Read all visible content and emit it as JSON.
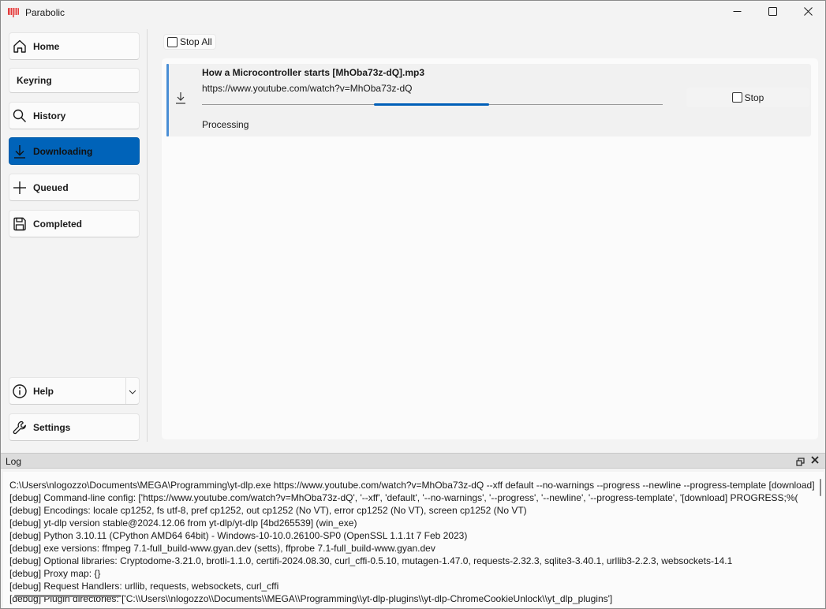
{
  "window": {
    "title": "Parabolic",
    "controls": {
      "minimize": "minimize",
      "maximize": "maximize",
      "close": "close"
    }
  },
  "sidebar": {
    "items": [
      {
        "label": "Home",
        "icon": "home-icon",
        "active": false
      },
      {
        "label": "Keyring",
        "icon": "",
        "active": false
      },
      {
        "label": "History",
        "icon": "search-icon",
        "active": false
      },
      {
        "label": "Downloading",
        "icon": "download-icon",
        "active": true
      },
      {
        "label": "Queued",
        "icon": "plus-icon",
        "active": false
      },
      {
        "label": "Completed",
        "icon": "save-icon",
        "active": false
      }
    ],
    "bottom_items": [
      {
        "label": "Help",
        "icon": "info-icon",
        "has_dropdown": true
      },
      {
        "label": "Settings",
        "icon": "wrench-icon"
      }
    ]
  },
  "toolbar": {
    "stop_all_label": "Stop All",
    "stop_all_checked": false
  },
  "downloads": [
    {
      "title": "How a Microcontroller starts [MhOba73z-dQ].mp3",
      "url": "https://www.youtube.com/watch?v=MhOba73z-dQ",
      "status": "Processing",
      "progress": "indeterminate",
      "stop_label": "Stop",
      "stop_checked": false
    }
  ],
  "log": {
    "title": "Log",
    "lines": [
      "C:\\Users\\nlogozzo\\Documents\\MEGA\\Programming\\yt-dlp.exe https://www.youtube.com/watch?v=MhOba73z-dQ --xff default --no-warnings --progress --newline --progress-template [download] PROGRESS;%(",
      "[debug] Command-line config: ['https://www.youtube.com/watch?v=MhOba73z-dQ', '--xff', 'default', '--no-warnings', '--progress', '--newline', '--progress-template', '[download] PROGRESS;%(",
      "[debug] Encodings: locale cp1252, fs utf-8, pref cp1252, out cp1252 (No VT), error cp1252 (No VT), screen cp1252 (No VT)",
      "[debug] yt-dlp version stable@2024.12.06 from yt-dlp/yt-dlp [4bd265539] (win_exe)",
      "[debug] Python 3.10.11 (CPython AMD64 64bit) - Windows-10-10.0.26100-SP0 (OpenSSL 1.1.1t  7 Feb 2023)",
      "[debug] exe versions: ffmpeg 7.1-full_build-www.gyan.dev (setts), ffprobe 7.1-full_build-www.gyan.dev",
      "[debug] Optional libraries: Cryptodome-3.21.0, brotli-1.1.0, certifi-2024.08.30, curl_cffi-0.5.10, mutagen-1.47.0, requests-2.32.3, sqlite3-3.40.1, urllib3-2.2.3, websockets-14.1",
      "[debug] Proxy map: {}",
      "[debug] Request Handlers: urllib, requests, websockets, curl_cffi",
      "[debug] Plugin directories: ['C:\\\\Users\\\\nlogozzo\\\\Documents\\\\MEGA\\\\Programming\\\\yt-dlp-plugins\\\\yt-dlp-ChromeCookieUnlock\\\\yt_dlp_plugins']"
    ]
  },
  "colors": {
    "accent": "#0063b9",
    "progress": "#005fb8",
    "row_accent": "#4a8fd6"
  }
}
